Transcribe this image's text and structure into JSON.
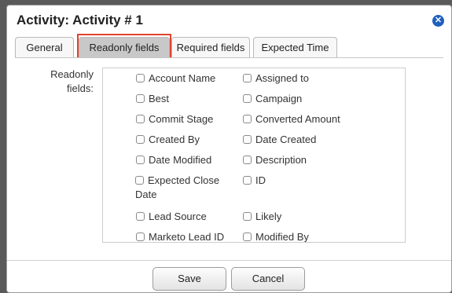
{
  "dialog": {
    "title": "Activity: Activity # 1",
    "close_symbol": "✕",
    "close_icon": "close-circle-icon",
    "accent_color": "#1f5fbf",
    "highlight_color": "#e2432e"
  },
  "tabs": [
    {
      "label": "General",
      "active": false
    },
    {
      "label": "Readonly fields",
      "active": true
    },
    {
      "label": "Required fields",
      "active": false
    },
    {
      "label": "Expected Time",
      "active": false
    }
  ],
  "readonly": {
    "label": "Readonly fields:",
    "left_column": [
      "Account Name",
      "Best",
      "Commit Stage",
      "Created By",
      "Date Modified",
      "Expected Close Date",
      "Lead Source",
      "Marketo Lead ID"
    ],
    "right_column": [
      "Assigned to",
      "Campaign",
      "Converted Amount",
      "Date Created",
      "Description",
      "ID",
      "Likely",
      "Modified By"
    ]
  },
  "buttons": {
    "save": "Save",
    "cancel": "Cancel"
  }
}
